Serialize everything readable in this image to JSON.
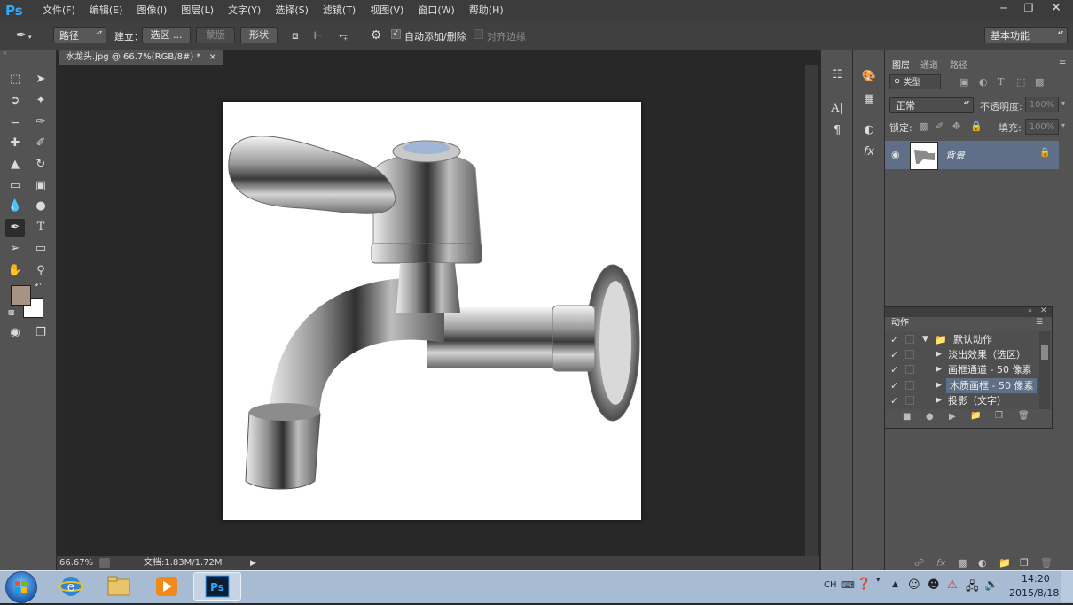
{
  "app": {
    "logo": "Ps"
  },
  "menu": [
    "文件(F)",
    "编辑(E)",
    "图像(I)",
    "图层(L)",
    "文字(Y)",
    "选择(S)",
    "滤镜(T)",
    "视图(V)",
    "窗口(W)",
    "帮助(H)"
  ],
  "options": {
    "mode": "路径",
    "build_label": "建立：",
    "selection_btn": "选区 ...",
    "mask_btn": "蒙版",
    "shape_btn": "形状",
    "auto_add_delete": "自动添加/删除",
    "auto_add_delete_checked": true,
    "align_edges": "对齐边缘",
    "align_edges_checked": false,
    "workspace": "基本功能"
  },
  "document": {
    "tab_title": "水龙头.jpg @ 66.7%(RGB/8#) *",
    "tab_close": "×",
    "zoom": "66.67%",
    "doc_info": "文档:1.83M/1.72M"
  },
  "layers_panel": {
    "tabs": [
      "图层",
      "通道",
      "路径"
    ],
    "filter_kind": "类型",
    "blend_mode": "正常",
    "opacity_label": "不透明度:",
    "opacity_value": "100%",
    "lock_label": "锁定:",
    "fill_label": "填充:",
    "fill_value": "100%",
    "layers": [
      {
        "name": "背景",
        "visible": true,
        "locked": true
      }
    ]
  },
  "actions_panel": {
    "title": "动作",
    "items": [
      {
        "label": "默认动作",
        "checked": true,
        "expanded": true,
        "is_set": true,
        "selected": false
      },
      {
        "label": "淡出效果（选区）",
        "checked": true,
        "expanded": false,
        "is_set": false,
        "selected": false
      },
      {
        "label": "画框通道 - 50 像素",
        "checked": true,
        "expanded": false,
        "is_set": false,
        "selected": false
      },
      {
        "label": "木质画框 - 50 像素",
        "checked": true,
        "expanded": false,
        "is_set": false,
        "selected": true
      },
      {
        "label": "投影（文字）",
        "checked": true,
        "expanded": false,
        "is_set": false,
        "selected": false
      }
    ]
  },
  "colors": {
    "foreground": "#a89383",
    "background": "#ffffff",
    "selection": "#5e6f87",
    "accent": "#31a8ff"
  },
  "taskbar": {
    "lang": "CH",
    "time": "14:20",
    "date": "2015/8/18"
  }
}
